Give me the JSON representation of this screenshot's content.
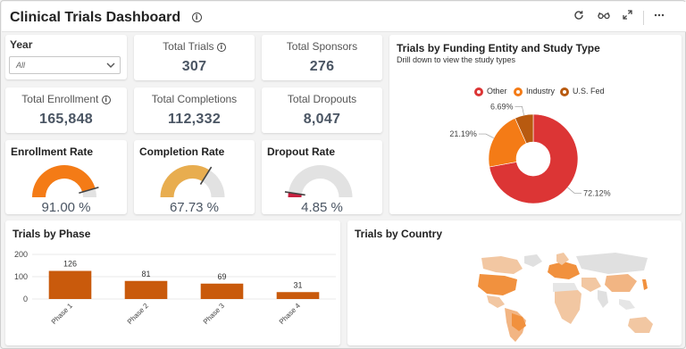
{
  "header": {
    "title": "Clinical Trials Dashboard",
    "info_icon": "info-icon",
    "actions": [
      "refresh-icon",
      "glasses-icon",
      "expand-icon",
      "more-icon"
    ]
  },
  "filter": {
    "label": "Year",
    "value": "All"
  },
  "kpis": {
    "total_trials": {
      "label": "Total Trials",
      "value": "307"
    },
    "total_sponsors": {
      "label": "Total Sponsors",
      "value": "276"
    },
    "total_enrollment": {
      "label": "Total Enrollment",
      "value": "165,848"
    },
    "total_completions": {
      "label": "Total Completions",
      "value": "112,332"
    },
    "total_dropouts": {
      "label": "Total Dropouts",
      "value": "8,047"
    }
  },
  "gauges": {
    "enrollment": {
      "title": "Enrollment Rate",
      "value_text": "91.00 %",
      "fraction": 0.91,
      "color": "#f47b16"
    },
    "completion": {
      "title": "Completion Rate",
      "value_text": "67.73 %",
      "fraction": 0.6773,
      "color": "#e8ad4f"
    },
    "dropout": {
      "title": "Dropout Rate",
      "value_text": "4.85 %",
      "fraction": 0.0485,
      "color": "#c8203f"
    }
  },
  "funding": {
    "title": "Trials by Funding Entity and Study Type",
    "subtitle": "Drill down to view the study types",
    "legend": [
      {
        "label": "Other",
        "color": "#dc3535"
      },
      {
        "label": "Industry",
        "color": "#f47b16"
      },
      {
        "label": "U.S. Fed",
        "color": "#b85a10"
      }
    ]
  },
  "phase_chart": {
    "title": "Trials by Phase"
  },
  "country_map": {
    "title": "Trials by Country"
  },
  "chart_data": [
    {
      "type": "pie",
      "title": "Trials by Funding Entity and Study Type",
      "subtitle": "Drill down to view the study types",
      "categories": [
        "Other",
        "Industry",
        "U.S. Fed"
      ],
      "values": [
        72.12,
        21.19,
        6.69
      ],
      "labels": [
        "72.12%",
        "21.19%",
        "6.69%"
      ],
      "colors": [
        "#dc3535",
        "#f47b16",
        "#b85a10"
      ],
      "legend": "top"
    },
    {
      "type": "bar",
      "title": "Trials by Phase",
      "categories": [
        "Phase 1",
        "Phase 2",
        "Phase 3",
        "Phase 4"
      ],
      "values": [
        126,
        81,
        69,
        31
      ],
      "ylim": [
        0,
        200
      ],
      "yticks": [
        0,
        100,
        200
      ],
      "color": "#c95a0c",
      "grid": true
    }
  ]
}
